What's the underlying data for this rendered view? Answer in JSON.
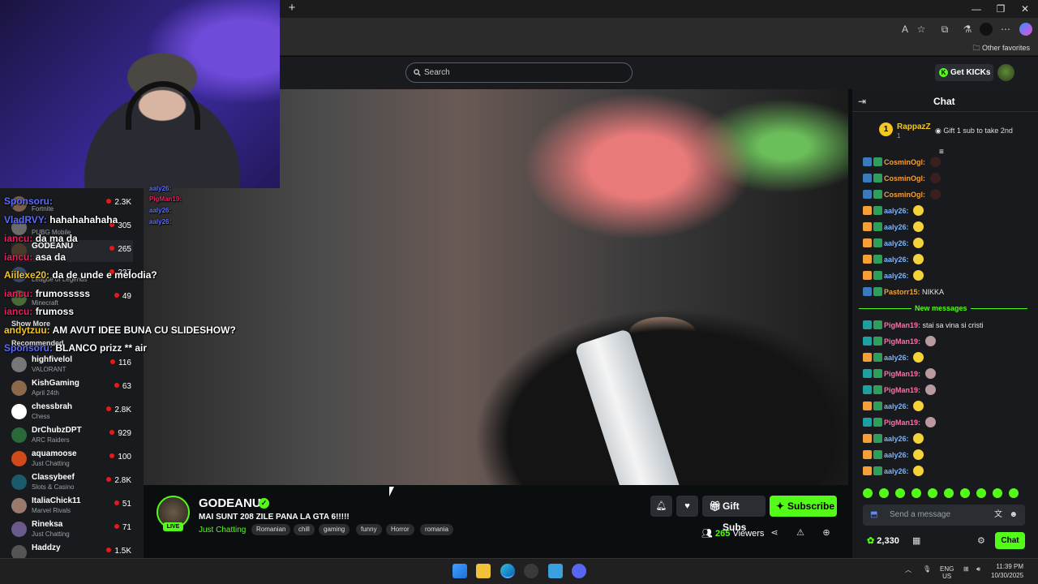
{
  "browser": {
    "new_tab": "+",
    "other_favorites": "Other favorites"
  },
  "header": {
    "search_placeholder": "Search",
    "get_kicks": "Get KICKs"
  },
  "sidebar": {
    "recommended_label": "Recommended",
    "show_more": "Show More",
    "following": [
      {
        "name": "",
        "category": "Fortnite",
        "viewers": "2.3K"
      },
      {
        "name": "",
        "category": "PUBG Mobile",
        "viewers": "305"
      },
      {
        "name": "GODEANU",
        "category": "",
        "viewers": "265"
      },
      {
        "name": "",
        "category": "League of Legends",
        "viewers": "237"
      },
      {
        "name": "",
        "category": "Minecraft",
        "viewers": "49"
      }
    ],
    "recommended": [
      {
        "name": "highfivelol",
        "category": "VALORANT",
        "viewers": "116"
      },
      {
        "name": "KishGaming",
        "category": "April 24th",
        "viewers": "63"
      },
      {
        "name": "chessbrah",
        "category": "Chess",
        "viewers": "2.8K"
      },
      {
        "name": "DrChubzDPT",
        "category": "ARC Raiders",
        "viewers": "929"
      },
      {
        "name": "aquamoose",
        "category": "Just Chatting",
        "viewers": "100"
      },
      {
        "name": "Classybeef",
        "category": "Slots & Casino",
        "viewers": "2.8K"
      },
      {
        "name": "ItaliaChick11",
        "category": "Marvel Rivals",
        "viewers": "51"
      },
      {
        "name": "Rineksa",
        "category": "Just Chatting",
        "viewers": "71"
      },
      {
        "name": "Haddzy",
        "category": "",
        "viewers": "1.5K"
      }
    ]
  },
  "overlay_chat": [
    {
      "user": "Sponsoru:",
      "text": "",
      "color": "#5b6cff"
    },
    {
      "user": "VladRVY:",
      "text": "hahahahahaha",
      "color": "#5b6cff"
    },
    {
      "user": "iancu:",
      "text": "da ma da",
      "color": "#e0245e"
    },
    {
      "user": "iancu:",
      "text": "asa da",
      "color": "#e0245e"
    },
    {
      "user": "Aiilexe20:",
      "text": "da de unde e melodia?",
      "color": "#f3c623"
    },
    {
      "user": "iancu:",
      "text": "frumosssss",
      "color": "#e0245e"
    },
    {
      "user": "iancu:",
      "text": "frumoss",
      "color": "#e0245e"
    },
    {
      "user": "andytzuu:",
      "text": "AM AVUT IDEE BUNA CU SLIDESHOW?",
      "color": "#f3c623"
    },
    {
      "user": "Sponsoru:",
      "text": "BLANCO prizz ** air",
      "color": "#5b6cff"
    }
  ],
  "overlay_small": [
    "aaly26:",
    "PigMan19:",
    "aaly26:",
    "aaly26:"
  ],
  "stream": {
    "name": "GODEANU",
    "title": "MAI SUNT 208 ZILE PANA LA GTA 6!!!!!",
    "category": "Just Chatting",
    "tags": [
      "Romanian",
      "chill",
      "gaming",
      "funny",
      "Horror",
      "romania"
    ],
    "live": "LIVE",
    "gift_subs": "Gift Subs",
    "subscribe": "Subscribe",
    "viewers_count": "265",
    "viewers_label": "Viewers"
  },
  "chat": {
    "title": "Chat",
    "pinned_rank": "1",
    "pinned_user": "RappazZ",
    "pinned_count": "1",
    "gift_prompt": "Gift 1 sub to take 2nd",
    "new_messages": "New messages",
    "input_placeholder": "Send a message",
    "kicks_balance": "2,330",
    "send_button": "Chat",
    "messages_before": [
      {
        "user": "CosminOgl:",
        "text": "",
        "color": "#f3a03a"
      },
      {
        "user": "CosminOgl:",
        "text": "",
        "color": "#f3a03a"
      },
      {
        "user": "CosminOgl:",
        "text": "",
        "color": "#f3a03a"
      },
      {
        "user": "aaly26:",
        "text": "",
        "color": "#7ab4ff"
      },
      {
        "user": "aaly26:",
        "text": "",
        "color": "#7ab4ff"
      },
      {
        "user": "aaly26:",
        "text": "",
        "color": "#7ab4ff"
      },
      {
        "user": "aaly26:",
        "text": "",
        "color": "#7ab4ff"
      },
      {
        "user": "aaly26:",
        "text": "",
        "color": "#7ab4ff"
      },
      {
        "user": "Pastorr15:",
        "text": "NIKKA",
        "color": "#f3a03a"
      }
    ],
    "messages_after": [
      {
        "user": "PigMan19:",
        "text": "stai sa vina si cristi",
        "color": "#ff6fa6"
      },
      {
        "user": "PigMan19:",
        "text": "",
        "color": "#ff6fa6"
      },
      {
        "user": "aaly26:",
        "text": "",
        "color": "#7ab4ff"
      },
      {
        "user": "PigMan19:",
        "text": "",
        "color": "#ff6fa6"
      },
      {
        "user": "PigMan19:",
        "text": "",
        "color": "#ff6fa6"
      },
      {
        "user": "aaly26:",
        "text": "",
        "color": "#7ab4ff"
      },
      {
        "user": "PigMan19:",
        "text": "",
        "color": "#ff6fa6"
      },
      {
        "user": "aaly26:",
        "text": "",
        "color": "#7ab4ff"
      },
      {
        "user": "aaly26:",
        "text": "",
        "color": "#7ab4ff"
      },
      {
        "user": "aaly26:",
        "text": "",
        "color": "#7ab4ff"
      }
    ]
  },
  "taskbar": {
    "lang1": "ENG",
    "lang2": "US",
    "time": "11:39 PM",
    "date": "10/30/2025"
  },
  "colors": {
    "accent": "#53fc18",
    "live": "#e91916",
    "gold": "#f3c623"
  }
}
